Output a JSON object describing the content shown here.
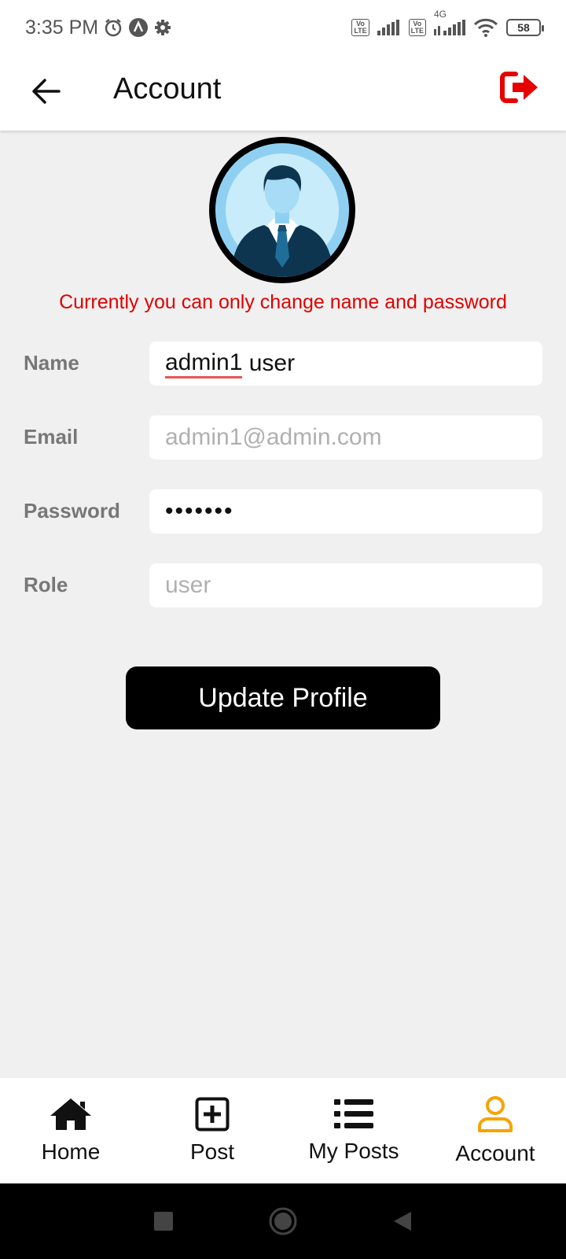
{
  "status_bar": {
    "time": "3:35 PM",
    "icons": [
      "alarm-icon",
      "nav-app-icon",
      "settings-gear-icon",
      "volte-icon",
      "signal-icon",
      "volte-icon",
      "4g-signal-icon",
      "wifi-icon",
      "battery-icon"
    ],
    "volte_top": "Vo",
    "volte_bottom": "LTE",
    "network_type": "4G",
    "battery_level": "58"
  },
  "app_bar": {
    "title": "Account",
    "back_icon": "arrow-left-icon",
    "logout_icon": "sign-out-icon",
    "logout_color": "#e60000"
  },
  "profile": {
    "avatar_icon": "businessman-avatar-icon",
    "notice": "Currently you can only change name and password",
    "notice_color": "#e00000"
  },
  "form": {
    "name_label": "Name",
    "name_value_part1": "admin1",
    "name_value_part2": " user",
    "email_label": "Email",
    "email_value": "admin1@admin.com",
    "password_label": "Password",
    "password_value": "•••••••",
    "role_label": "Role",
    "role_value": "user"
  },
  "update_button": {
    "label": "Update Profile"
  },
  "bottom_nav": {
    "items": [
      {
        "label": "Home",
        "icon": "home-icon"
      },
      {
        "label": "Post",
        "icon": "plus-square-icon"
      },
      {
        "label": "My Posts",
        "icon": "list-icon"
      },
      {
        "label": "Account",
        "icon": "user-icon"
      }
    ],
    "active_index": 3,
    "active_color": "#f5a400"
  },
  "system_nav": {
    "icons": [
      "recents-square-icon",
      "home-circle-icon",
      "back-triangle-icon"
    ]
  }
}
